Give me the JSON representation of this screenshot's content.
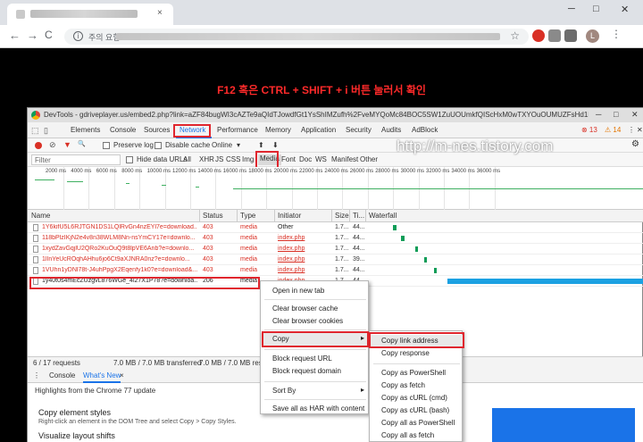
{
  "browser": {
    "tab_close": "×",
    "win_min": "─",
    "win_max": "□",
    "win_close": "✕",
    "back": "←",
    "forward": "→",
    "reload": "C",
    "info": "i",
    "security_label": "주의 요함",
    "star": "☆",
    "avatar_letter": "L",
    "menu": "⋮"
  },
  "instruction": "F12 혹은 CTRL + SHIFT + i 버튼 눌러서 확인",
  "devtools": {
    "title": "DevTools - gdriveplayer.us/embed2.php?link=aZF84bugWI3cAZTe9aQIdTJowdfGt1YsShIMZufh%2FveMYQoMc84BOC5SW1ZuUOUmkfQIScHxM0wTXYOuOUMUZFsHd1hTc7...",
    "win_min": "─",
    "win_max": "□",
    "win_close": "✕",
    "tabs": [
      "Elements",
      "Console",
      "Sources",
      "Network",
      "Performance",
      "Memory",
      "Application",
      "Security",
      "Audits",
      "AdBlock"
    ],
    "errors": "⊗ 13",
    "warnings": "⚠ 14",
    "more": "⋮",
    "settings": "⚙",
    "close": "✕",
    "toolbar": {
      "clear": "⊘",
      "filter_icon": "▼",
      "search_icon": "🔍",
      "preserve_log": "Preserve log",
      "disable_cache": "Disable cache",
      "online": "Online",
      "online_arrow": "▾",
      "upload": "⬆",
      "download": "⬇"
    },
    "filter": {
      "placeholder": "Filter",
      "hide_data_urls": "Hide data URLs",
      "types": [
        "All",
        "XHR",
        "JS",
        "CSS",
        "Img",
        "Media",
        "Font",
        "Doc",
        "WS",
        "Manifest",
        "Other"
      ],
      "selected": "Media"
    },
    "timeline_ticks": [
      "2000 ms",
      "4000 ms",
      "6000 ms",
      "8000 ms",
      "10000 ms",
      "12000 ms",
      "14000 ms",
      "16000 ms",
      "18000 ms",
      "20000 ms",
      "22000 ms",
      "24000 ms",
      "26000 ms",
      "28000 ms",
      "30000 ms",
      "32000 ms",
      "34000 ms",
      "36000 ms"
    ],
    "columns": {
      "name": "Name",
      "status": "Status",
      "type": "Type",
      "initiator": "Initiator",
      "size": "Size",
      "time": "Ti...",
      "waterfall": "Waterfall"
    },
    "requests": [
      {
        "name": "1Y6kifU5L6RJTGN1DS1LQlRvGn4nzEYl7e=download...",
        "status": "403",
        "type": "media",
        "initiator": "Other",
        "size": "1.7...",
        "time": "44...",
        "wf_start": 0.088,
        "wf_len": 0.012
      },
      {
        "name": "118bPlzIKjN2e4v8n38WLM8Nn-nsYmCY17e=downlo...",
        "status": "403",
        "type": "media",
        "initiator": "index.php",
        "size": "1.7...",
        "time": "44...",
        "wf_start": 0.118,
        "wf_len": 0.012
      },
      {
        "name": "1xydZavGqjlU2QRo2KuOuQ9t8lpVE6Anb?e=downlo...",
        "status": "403",
        "type": "media",
        "initiator": "index.php",
        "size": "1.7...",
        "time": "44...",
        "wf_start": 0.17,
        "wf_len": 0.006
      },
      {
        "name": "1lInYeUcROqhAHhu6jo6Ct9aXJNRA0nz?e=downlo...",
        "status": "403",
        "type": "media",
        "initiator": "index.php",
        "size": "1.7...",
        "time": "39...",
        "wf_start": 0.2,
        "wf_len": 0.006
      },
      {
        "name": "1VUhn1yDNl78t-J4uhPpgX2Eqenfy1k0?e=download&...",
        "status": "403",
        "type": "media",
        "initiator": "index.php",
        "size": "1.7...",
        "time": "44...",
        "wf_start": 0.238,
        "wf_len": 0.006
      },
      {
        "name": "1y40t0s4mEcZUzgvL876WGe_4l27X1P78?e=downloa...",
        "status": "206",
        "type": "media",
        "initiator": "index.php",
        "size": "1.7...",
        "time": "44...",
        "wf_start": 0.285,
        "wf_len": 0.715
      }
    ],
    "status_bar": {
      "requests": "6 / 17 requests",
      "transferred": "7.0 MB / 7.0 MB transferred",
      "resources": "7.0 MB / 7.0 MB resources"
    },
    "drawer": {
      "menu": "⋮",
      "tabs": [
        "Console",
        "What's New"
      ],
      "close": "×",
      "highlight": "Highlights from the Chrome 77 update",
      "feature1_title": "Copy element styles",
      "feature1_desc": "Right-click an element in the DOM Tree and select Copy > Copy Styles.",
      "feature2_title": "Visualize layout shifts"
    }
  },
  "watermark": "http://m-nes.tistory.com",
  "context_menu": {
    "items": [
      "Open in new tab",
      "Clear browser cache",
      "Clear browser cookies",
      "Copy",
      "Block request URL",
      "Block request domain",
      "Sort By",
      "Save all as HAR with content"
    ],
    "arrow": "▸"
  },
  "copy_submenu": {
    "items": [
      "Copy link address",
      "Copy response",
      "Copy as PowerShell",
      "Copy as fetch",
      "Copy as cURL (cmd)",
      "Copy as cURL (bash)",
      "Copy all as PowerShell",
      "Copy all as fetch"
    ]
  }
}
